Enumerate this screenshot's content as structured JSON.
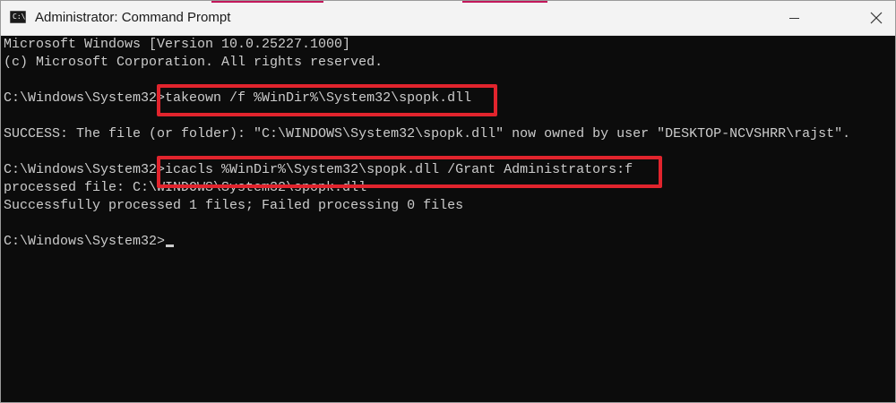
{
  "window": {
    "title": "Administrator: Command Prompt",
    "icon_label": "C:\\",
    "accent_color": "#c2185b"
  },
  "console": {
    "lines": [
      {
        "prompt": "",
        "text": "Microsoft Windows [Version 10.0.25227.1000]"
      },
      {
        "prompt": "",
        "text": "(c) Microsoft Corporation. All rights reserved."
      },
      {
        "prompt": "",
        "text": ""
      },
      {
        "prompt": "C:\\Windows\\System32>",
        "text": "takeown /f %WinDir%\\System32\\spopk.dll"
      },
      {
        "prompt": "",
        "text": ""
      },
      {
        "prompt": "",
        "text": "SUCCESS: The file (or folder): \"C:\\WINDOWS\\System32\\spopk.dll\" now owned by user \"DESKTOP-NCVSHRR\\rajst\"."
      },
      {
        "prompt": "",
        "text": ""
      },
      {
        "prompt": "C:\\Windows\\System32>",
        "text": "icacls %WinDir%\\System32\\spopk.dll /Grant Administrators:f"
      },
      {
        "prompt": "",
        "text": "processed file: C:\\WINDOWS\\System32\\spopk.dll"
      },
      {
        "prompt": "",
        "text": "Successfully processed 1 files; Failed processing 0 files"
      },
      {
        "prompt": "",
        "text": ""
      },
      {
        "prompt": "C:\\Windows\\System32>",
        "text": ""
      }
    ],
    "text_color": "#cccccc",
    "background_color": "#0c0c0c",
    "highlight_color": "#e1242d"
  }
}
